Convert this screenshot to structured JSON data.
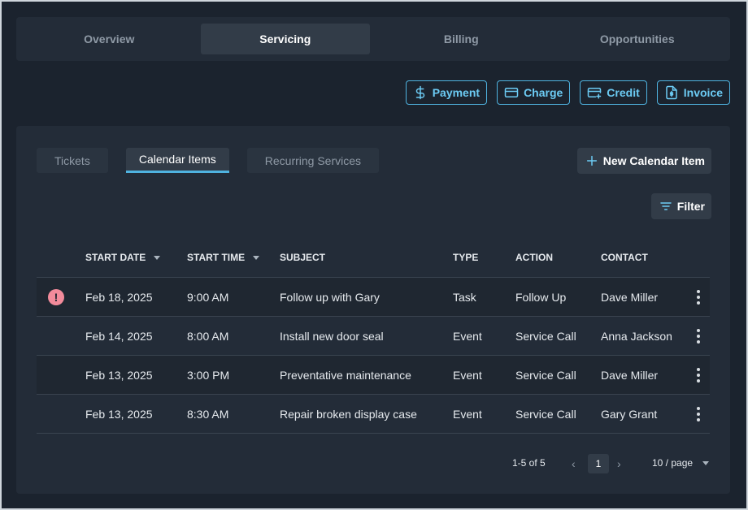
{
  "top_tabs": [
    {
      "label": "Overview"
    },
    {
      "label": "Servicing"
    },
    {
      "label": "Billing"
    },
    {
      "label": "Opportunities"
    }
  ],
  "actions": {
    "payment": "Payment",
    "charge": "Charge",
    "credit": "Credit",
    "invoice": "Invoice"
  },
  "sub_tabs": [
    {
      "label": "Tickets"
    },
    {
      "label": "Calendar Items"
    },
    {
      "label": "Recurring Services"
    }
  ],
  "new_item_label": "New Calendar Item",
  "filter_label": "Filter",
  "table": {
    "headers": {
      "start_date": "START DATE",
      "start_time": "START TIME",
      "subject": "SUBJECT",
      "type": "TYPE",
      "action": "ACTION",
      "contact": "CONTACT"
    },
    "rows": [
      {
        "date": "Feb 18, 2025",
        "time": "9:00 AM",
        "subject": "Follow up with Gary",
        "type": "Task",
        "action": "Follow Up",
        "contact": "Dave Miller",
        "alert": "!"
      },
      {
        "date": "Feb 14, 2025",
        "time": "8:00 AM",
        "subject": "Install new door seal",
        "type": "Event",
        "action": "Service Call",
        "contact": "Anna Jackson"
      },
      {
        "date": "Feb 13, 2025",
        "time": "3:00 PM",
        "subject": "Preventative maintenance",
        "type": "Event",
        "action": "Service Call",
        "contact": "Dave Miller"
      },
      {
        "date": "Feb 13, 2025",
        "time": "8:30 AM",
        "subject": "Repair broken display case",
        "type": "Event",
        "action": "Service Call",
        "contact": "Gary Grant"
      }
    ]
  },
  "pagination": {
    "range": "1-5 of 5",
    "page": "1",
    "per_page": "10 / page"
  },
  "colors": {
    "accent": "#4fb3e0",
    "alert": "#f28b9b",
    "background": "#1b232e",
    "panel": "#232c38"
  }
}
